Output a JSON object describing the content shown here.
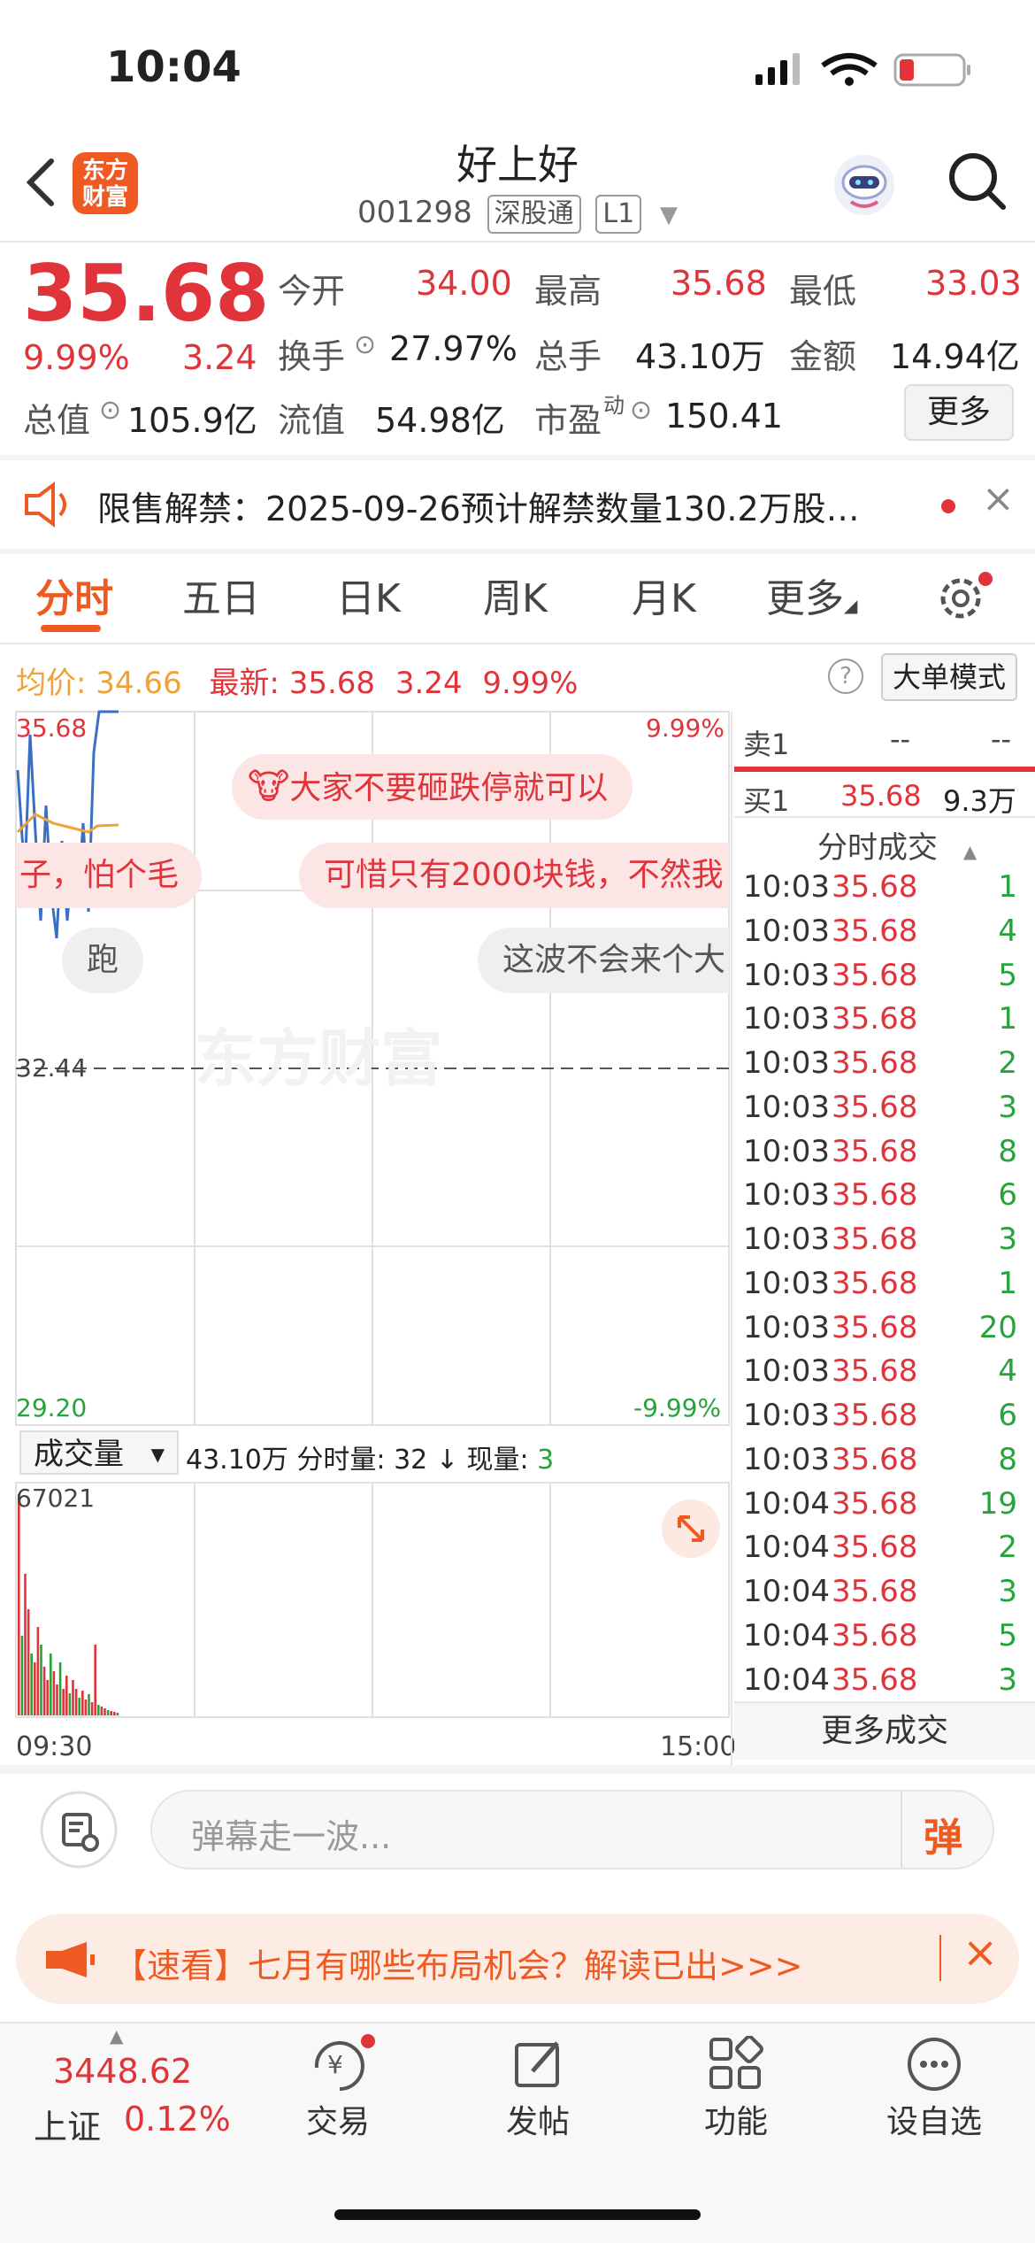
{
  "status_bar": {
    "time": "10:04"
  },
  "header": {
    "logo_line1": "东方",
    "logo_line2": "财富",
    "stock_name": "好上好",
    "stock_code": "001298",
    "tag1": "深股通",
    "tag2": "L1"
  },
  "quote": {
    "price": "35.68",
    "change_pct": "9.99%",
    "change": "3.24",
    "open_label": "今开",
    "open": "34.00",
    "high_label": "最高",
    "high": "35.68",
    "low_label": "最低",
    "low": "33.03",
    "turnover_label": "换手",
    "turnover": "27.97%",
    "volume_label": "总手",
    "volume": "43.10万",
    "amount_label": "金额",
    "amount": "14.94亿",
    "mcap_label": "总值",
    "mcap": "105.9亿",
    "float_label": "流值",
    "float": "54.98亿",
    "pe_label": "市盈",
    "pe_sup": "动",
    "pe": "150.41",
    "more_button": "更多"
  },
  "notice": {
    "text": "限售解禁：2025-09-26预计解禁数量130.2万股…"
  },
  "tabs": [
    "分时",
    "五日",
    "日K",
    "周K",
    "月K",
    "更多"
  ],
  "summary": {
    "avg_label": "均价:",
    "avg": "34.66",
    "latest_label": "最新:",
    "latest": "35.68",
    "latest_change": "3.24",
    "latest_pct": "9.99%",
    "mode_button": "大单模式"
  },
  "chart_labels": {
    "top_price": "35.68",
    "top_pct": "9.99%",
    "mid_price": "32.44",
    "bottom_price": "29.20",
    "bottom_pct": "-9.99%",
    "volume_max": "67021",
    "time_start": "09:30",
    "time_end": "15:00",
    "watermark": "东方财富"
  },
  "danmaku": [
    "大家不要砸跌停就可以",
    "子，怕个毛",
    "可惜只有2000块钱，不然我",
    "跑",
    "这波不会来个大"
  ],
  "volume_bar": {
    "selector": "成交量",
    "total": "43.10万",
    "minute_label": "分时量:",
    "minute_value": "32",
    "now_label": "现量:",
    "now_value": "3"
  },
  "order_book": {
    "sell1_label": "卖1",
    "sell1_price": "--",
    "sell1_vol": "--",
    "buy1_label": "买1",
    "buy1_price": "35.68",
    "buy1_vol": "9.3万"
  },
  "trades_header": "分时成交",
  "trades": [
    {
      "time": "10:03",
      "price": "35.68",
      "vol": "1"
    },
    {
      "time": "10:03",
      "price": "35.68",
      "vol": "4"
    },
    {
      "time": "10:03",
      "price": "35.68",
      "vol": "5"
    },
    {
      "time": "10:03",
      "price": "35.68",
      "vol": "1"
    },
    {
      "time": "10:03",
      "price": "35.68",
      "vol": "2"
    },
    {
      "time": "10:03",
      "price": "35.68",
      "vol": "3"
    },
    {
      "time": "10:03",
      "price": "35.68",
      "vol": "8"
    },
    {
      "time": "10:03",
      "price": "35.68",
      "vol": "6"
    },
    {
      "time": "10:03",
      "price": "35.68",
      "vol": "3"
    },
    {
      "time": "10:03",
      "price": "35.68",
      "vol": "1"
    },
    {
      "time": "10:03",
      "price": "35.68",
      "vol": "20"
    },
    {
      "time": "10:03",
      "price": "35.68",
      "vol": "4"
    },
    {
      "time": "10:03",
      "price": "35.68",
      "vol": "6"
    },
    {
      "time": "10:03",
      "price": "35.68",
      "vol": "8"
    },
    {
      "time": "10:04",
      "price": "35.68",
      "vol": "19"
    },
    {
      "time": "10:04",
      "price": "35.68",
      "vol": "2"
    },
    {
      "time": "10:04",
      "price": "35.68",
      "vol": "3"
    },
    {
      "time": "10:04",
      "price": "35.68",
      "vol": "5"
    },
    {
      "time": "10:04",
      "price": "35.68",
      "vol": "3"
    }
  ],
  "more_trades": "更多成交",
  "comment_input": {
    "placeholder": "弹幕走一波..."
  },
  "danmaku_button": "弹",
  "promo": {
    "text": "【速看】七月有哪些布局机会？解读已出>>>"
  },
  "index": {
    "value": "3448.62",
    "name": "上证",
    "pct": "0.12%"
  },
  "bottom_nav": [
    "交易",
    "发帖",
    "功能",
    "设自选"
  ]
}
